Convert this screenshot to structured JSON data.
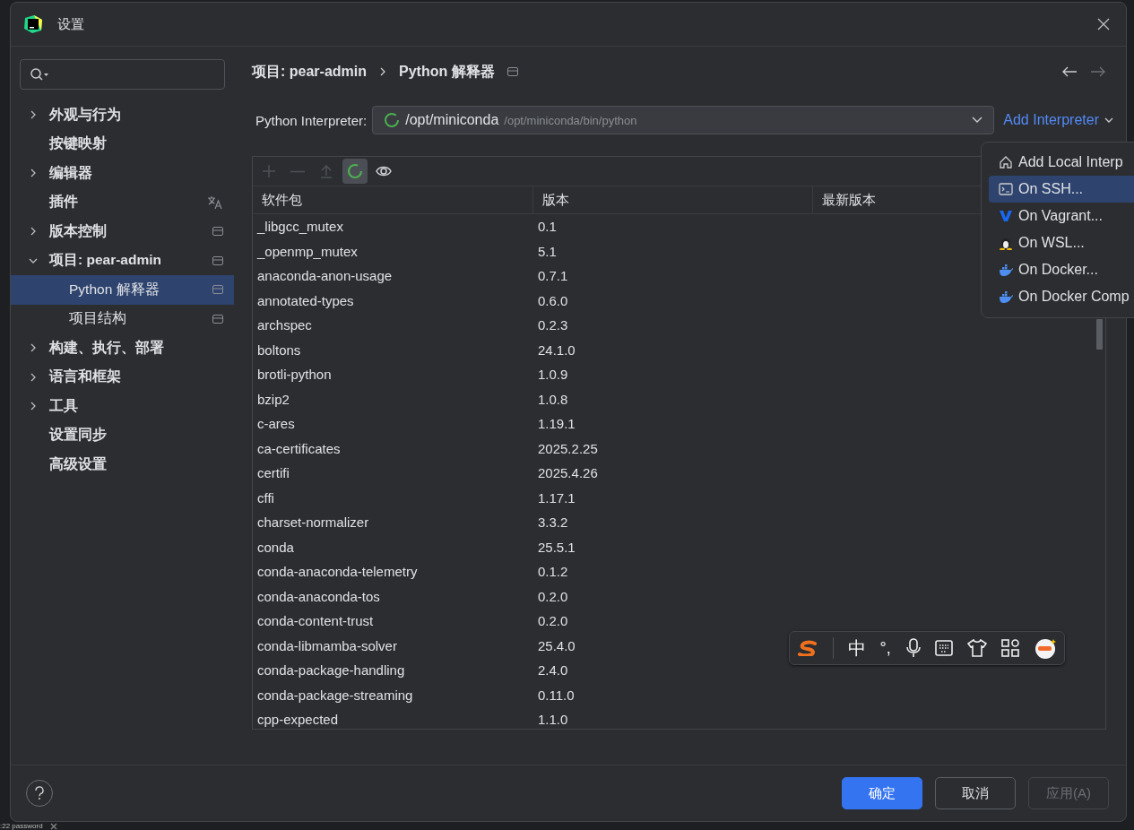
{
  "window": {
    "title": "设置"
  },
  "sidebar": {
    "items": [
      {
        "kind": "plain",
        "label": "外观与行为",
        "expanded": false,
        "selected": false
      },
      {
        "kind": "plain",
        "label": "按键映射",
        "selected": false
      },
      {
        "kind": "plain",
        "label": "编辑器",
        "expanded": false,
        "selected": false
      },
      {
        "kind": "plugin",
        "label": "插件",
        "selected": false
      },
      {
        "kind": "project",
        "label": "版本控制",
        "expanded": false,
        "selected": false
      },
      {
        "kind": "project",
        "label": "项目: pear-admin",
        "expanded": true,
        "selected": false,
        "children": [
          {
            "kind": "project",
            "label": "Python 解释器",
            "selected": true
          },
          {
            "kind": "project",
            "label": "项目结构",
            "selected": false
          }
        ]
      },
      {
        "kind": "plain",
        "label": "构建、执行、部署",
        "expanded": false,
        "selected": false
      },
      {
        "kind": "plain",
        "label": "语言和框架",
        "expanded": false,
        "selected": false
      },
      {
        "kind": "plain",
        "label": "工具",
        "expanded": false,
        "selected": false
      },
      {
        "kind": "plain",
        "label": "设置同步",
        "selected": false
      },
      {
        "kind": "plain",
        "label": "高级设置",
        "selected": false
      }
    ]
  },
  "breadcrumb": [
    "项目: pear-admin",
    "Python 解释器"
  ],
  "interpreter": {
    "label": "Python Interpreter:",
    "name": "/opt/miniconda",
    "path": "/opt/miniconda/bin/python",
    "add_label": "Add Interpreter"
  },
  "toolbar": [
    {
      "kind": "add",
      "disabled": true,
      "selected": false
    },
    {
      "kind": "remove",
      "disabled": true,
      "selected": false
    },
    {
      "kind": "upgrade",
      "disabled": true,
      "selected": false
    },
    {
      "kind": "loading",
      "disabled": false,
      "selected": true
    },
    {
      "kind": "eye",
      "disabled": false,
      "selected": false
    }
  ],
  "table": {
    "columns": [
      "软件包",
      "版本",
      "最新版本"
    ],
    "rows": [
      [
        "_libgcc_mutex",
        "0.1"
      ],
      [
        "_openmp_mutex",
        "5.1"
      ],
      [
        "anaconda-anon-usage",
        "0.7.1"
      ],
      [
        "annotated-types",
        "0.6.0"
      ],
      [
        "archspec",
        "0.2.3"
      ],
      [
        "boltons",
        "24.1.0"
      ],
      [
        "brotli-python",
        "1.0.9"
      ],
      [
        "bzip2",
        "1.0.8"
      ],
      [
        "c-ares",
        "1.19.1"
      ],
      [
        "ca-certificates",
        "2025.2.25"
      ],
      [
        "certifi",
        "2025.4.26"
      ],
      [
        "cffi",
        "1.17.1"
      ],
      [
        "charset-normalizer",
        "3.3.2"
      ],
      [
        "conda",
        "25.5.1"
      ],
      [
        "conda-anaconda-telemetry",
        "0.1.2"
      ],
      [
        "conda-anaconda-tos",
        "0.2.0"
      ],
      [
        "conda-content-trust",
        "0.2.0"
      ],
      [
        "conda-libmamba-solver",
        "25.4.0"
      ],
      [
        "conda-package-handling",
        "2.4.0"
      ],
      [
        "conda-package-streaming",
        "0.11.0"
      ],
      [
        "cpp-expected",
        "1.1.0"
      ]
    ]
  },
  "menu": {
    "items": [
      {
        "kind": "home",
        "label": "Add Local Interp",
        "selected": false
      },
      {
        "kind": "terminal",
        "label": "On SSH...",
        "selected": true
      },
      {
        "kind": "vagrant",
        "label": "On Vagrant...",
        "selected": false
      },
      {
        "kind": "linux",
        "label": "On WSL...",
        "selected": false
      },
      {
        "kind": "docker",
        "label": "On Docker...",
        "selected": false
      },
      {
        "kind": "docker",
        "label": "On Docker Comp",
        "selected": false
      }
    ]
  },
  "ime_toolbar": {
    "mode": "中",
    "punctuation": "°,"
  },
  "buttons": [
    {
      "label": "确定",
      "kind": "primary",
      "disabled": false
    },
    {
      "label": "取消",
      "kind": "normal",
      "disabled": false
    },
    {
      "label": "应用(A)",
      "kind": "normal",
      "disabled": true
    }
  ],
  "background_tab": {
    "label": ":22 password"
  }
}
